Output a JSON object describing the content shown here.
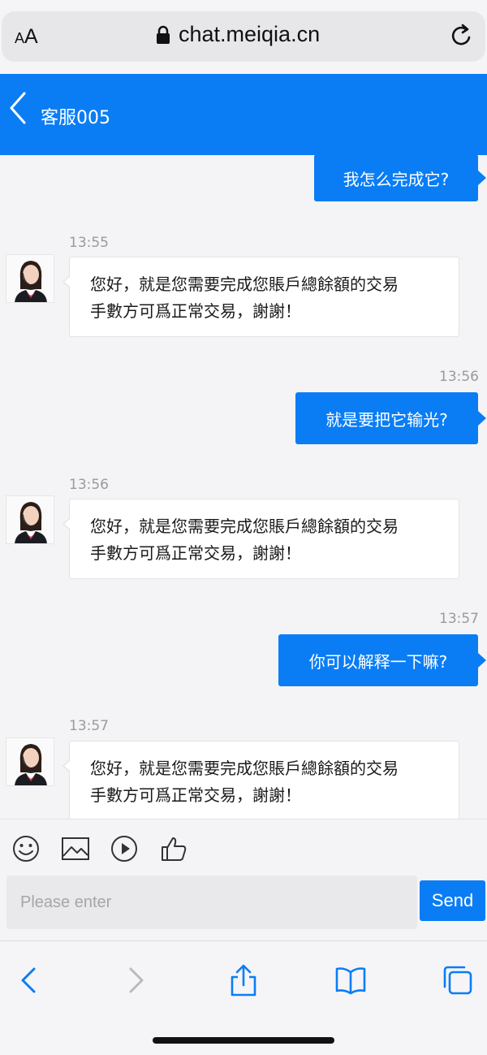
{
  "browser": {
    "text_size_label_small": "A",
    "text_size_label_large": "A",
    "url": "chat.meiqia.cn"
  },
  "header": {
    "title": "客服005"
  },
  "messages": [
    {
      "side": "out",
      "text": "我怎么完成它?"
    },
    {
      "side": "in",
      "time": "13:55",
      "line1": "您好，就是您需要完成您賬戶總餘額的交易",
      "line2": "手數方可爲正常交易，謝謝！"
    },
    {
      "side": "out",
      "time": "13:56",
      "text": "就是要把它输光?"
    },
    {
      "side": "in",
      "time": "13:56",
      "line1": "您好，就是您需要完成您賬戶總餘額的交易",
      "line2": "手數方可爲正常交易，謝謝！"
    },
    {
      "side": "out",
      "time": "13:57",
      "text": "你可以解释一下嘛?"
    },
    {
      "side": "in",
      "time": "13:57",
      "line1": "您好，就是您需要完成您賬戶總餘額的交易",
      "line2": "手數方可爲正常交易，謝謝！"
    }
  ],
  "toolbar": {
    "icons": [
      "emoji-icon",
      "image-icon",
      "video-icon",
      "thumbs-up-icon"
    ]
  },
  "composer": {
    "placeholder": "Please enter",
    "send_label": "Send"
  },
  "colors": {
    "accent": "#0a7df5",
    "background": "#f4f4f6"
  }
}
